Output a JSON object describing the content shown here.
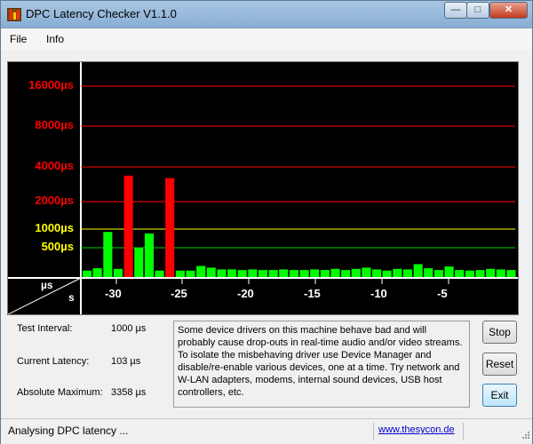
{
  "window": {
    "title": "DPC Latency Checker V1.1.0",
    "controls": {
      "minimize": "—",
      "maximize": "□",
      "close": "✕"
    }
  },
  "menu": [
    "File",
    "Info"
  ],
  "chart_data": {
    "type": "bar",
    "y_scale": "piecewise",
    "y_labels": [
      {
        "text": "16000µs",
        "color": "#ff0000"
      },
      {
        "text": "8000µs",
        "color": "#ff0000"
      },
      {
        "text": "4000µs",
        "color": "#ff0000"
      },
      {
        "text": "2000µs",
        "color": "#ff0000"
      },
      {
        "text": "1000µs",
        "color": "#ffff00"
      },
      {
        "text": "500µs",
        "color": "#ffff00"
      }
    ],
    "x_labels": [
      "-30",
      "-25",
      "-20",
      "-15",
      "-10",
      "-5"
    ],
    "corner_labels": {
      "y_unit": "µs",
      "x_unit": "s"
    },
    "bar_values_us": [
      110,
      150,
      900,
      140,
      3358,
      500,
      850,
      110,
      3200,
      110,
      110,
      190,
      160,
      130,
      130,
      120,
      130,
      120,
      120,
      130,
      120,
      120,
      130,
      120,
      140,
      120,
      140,
      160,
      130,
      110,
      140,
      130,
      220,
      150,
      120,
      180,
      120,
      110,
      120,
      140,
      130,
      120
    ],
    "bar_colors": {
      "normal": "#00ff00",
      "critical": "#ff0000"
    },
    "grid_colors": {
      "red": "#ff0000",
      "yellow": "#ffff00",
      "green": "#00d000"
    }
  },
  "stats": [
    {
      "label": "Test Interval:",
      "value": "1000 µs"
    },
    {
      "label": "Current Latency:",
      "value": "103 µs"
    },
    {
      "label": "Absolute Maximum:",
      "value": "3358 µs"
    }
  ],
  "message": "Some device drivers on this machine behave bad and will probably cause drop-outs in real-time audio and/or video streams. To isolate the misbehaving driver use Device Manager and disable/re-enable various devices, one at a time. Try network and W-LAN adapters, modems, internal sound devices, USB host controllers, etc.",
  "buttons": {
    "stop": "Stop",
    "reset": "Reset",
    "exit": "Exit"
  },
  "status": {
    "text": "Analysing DPC latency ...",
    "link": "www.thesycon.de"
  }
}
